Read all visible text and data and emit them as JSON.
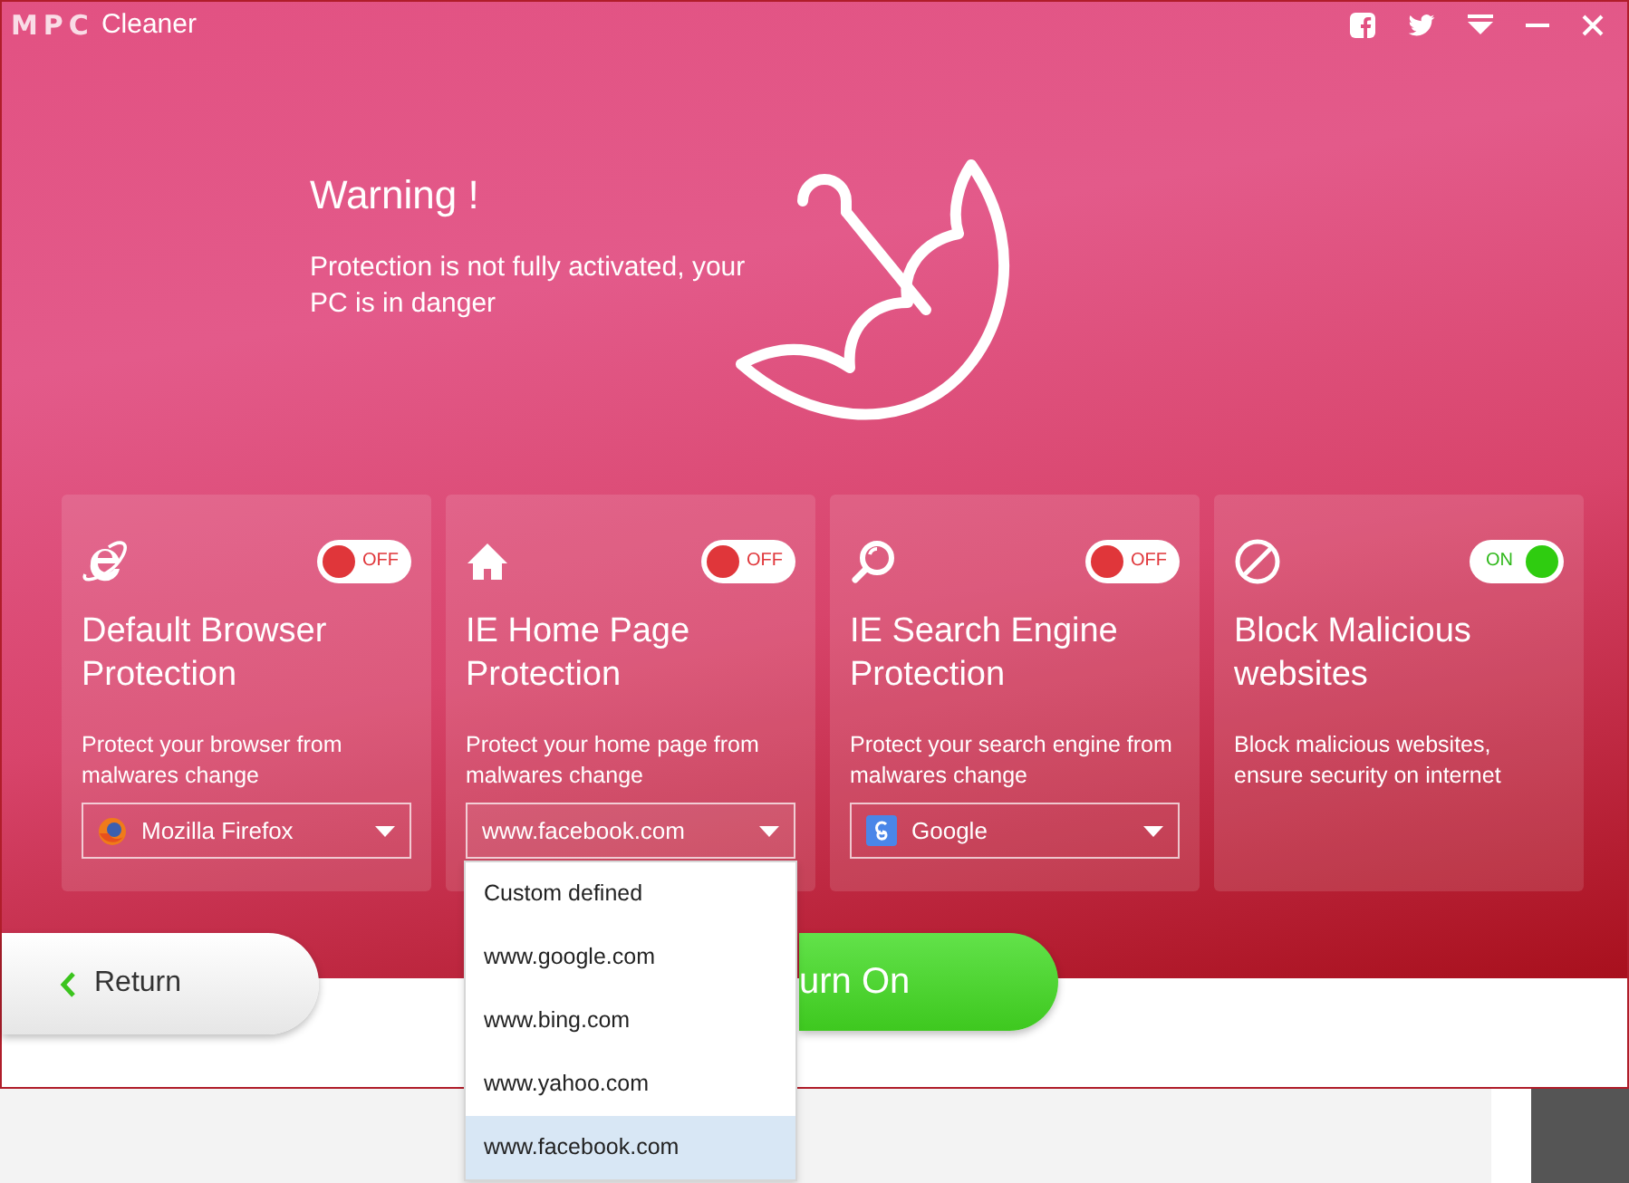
{
  "app": {
    "logo_mark": "MPC",
    "logo_text": "Cleaner"
  },
  "warning": {
    "title": "Warning !",
    "message": "Protection is not fully activated, your PC is in danger"
  },
  "cards": [
    {
      "kind": "browser",
      "title": "Default Browser Protection",
      "description": "Protect your browser from malwares change",
      "toggle": {
        "on": false,
        "label": "OFF"
      },
      "select": {
        "kind": "firefox",
        "value": "Mozilla Firefox"
      }
    },
    {
      "kind": "home",
      "title": "IE Home Page Protection",
      "description": "Protect your home page from malwares change",
      "toggle": {
        "on": false,
        "label": "OFF"
      },
      "select": {
        "value": "www.facebook.com",
        "expanded": true,
        "options": [
          {
            "label": "Custom defined",
            "selected": false
          },
          {
            "label": "www.google.com",
            "selected": false
          },
          {
            "label": "www.bing.com",
            "selected": false
          },
          {
            "label": "www.yahoo.com",
            "selected": false
          },
          {
            "label": "www.facebook.com",
            "selected": true
          }
        ]
      }
    },
    {
      "kind": "search",
      "title": "IE Search Engine Protection",
      "description": "Protect your search engine from malwares change",
      "toggle": {
        "on": false,
        "label": "OFF"
      },
      "select": {
        "kind": "google",
        "value": "Google"
      }
    },
    {
      "kind": "block",
      "title": "Block Malicious websites",
      "description": "Block malicious websites, ensure security on internet",
      "toggle": {
        "on": true,
        "label": "ON"
      }
    }
  ],
  "footer": {
    "return_label": "Return",
    "turn_on_label": "urn On"
  }
}
